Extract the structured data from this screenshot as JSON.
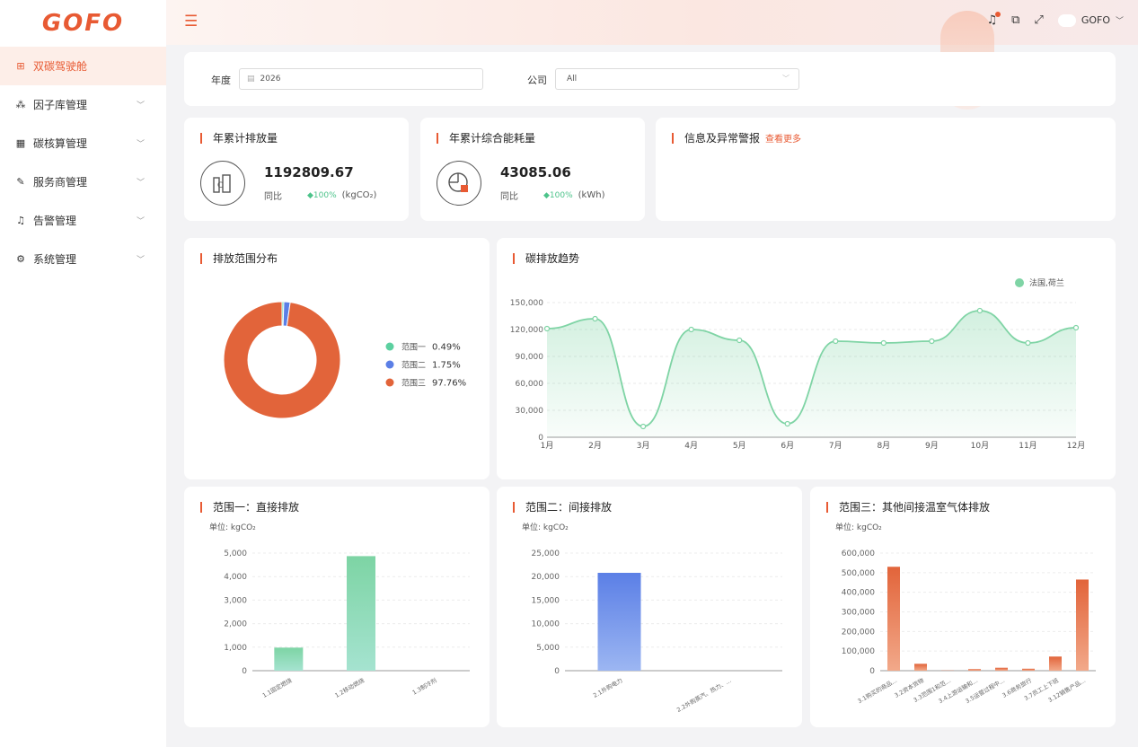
{
  "brand": {
    "logo_text": "GOFO",
    "accent": "#e85a33"
  },
  "sidebar": {
    "items": [
      {
        "label": "双碳驾驶舱",
        "icon": "grid-icon",
        "active": true
      },
      {
        "label": "因子库管理",
        "icon": "factor-icon",
        "active": false
      },
      {
        "label": "碳核算管理",
        "icon": "calc-icon",
        "active": false
      },
      {
        "label": "服务商管理",
        "icon": "provider-icon",
        "active": false
      },
      {
        "label": "告警管理",
        "icon": "bell-icon",
        "active": false
      },
      {
        "label": "系统管理",
        "icon": "settings-icon",
        "active": false
      }
    ]
  },
  "topbar": {
    "user_name": "GOFO"
  },
  "filters": {
    "year_label": "年度",
    "year_value": "2026",
    "company_label": "公司",
    "company_value": "All"
  },
  "kpis": {
    "emission": {
      "title": "年累计排放量",
      "value": "1192809.67",
      "yoy_label": "同比",
      "change": "100%",
      "unit": "(kgCO₂)"
    },
    "energy": {
      "title": "年累计综合能耗量",
      "value": "43085.06",
      "yoy_label": "同比",
      "change": "100%",
      "unit": "(kWh)"
    },
    "alerts": {
      "title": "信息及异常警报",
      "more_link": "查看更多"
    }
  },
  "scope_distribution": {
    "title": "排放范围分布",
    "chart_data": {
      "type": "pie",
      "labels": [
        "范围一",
        "范围二",
        "范围三"
      ],
      "values": [
        0.49,
        1.75,
        97.76
      ],
      "value_labels": [
        "0.49%",
        "1.75%",
        "97.76%"
      ],
      "colors": [
        "#5cd0a0",
        "#5b7fe6",
        "#e2643a"
      ]
    }
  },
  "trend": {
    "title": "碳排放趋势",
    "chart_data": {
      "type": "area",
      "x": [
        "1月",
        "2月",
        "3月",
        "4月",
        "5月",
        "6月",
        "7月",
        "8月",
        "9月",
        "10月",
        "11月",
        "12月"
      ],
      "series": [
        {
          "name": "法国,荷兰",
          "values": [
            121000,
            132000,
            12000,
            120000,
            108000,
            15000,
            107000,
            105000,
            107000,
            141000,
            105000,
            122000
          ],
          "color": "#7fd4a5"
        }
      ],
      "yticks": [
        "0",
        "30,000",
        "60,000",
        "90,000",
        "120,000",
        "150,000"
      ],
      "ylim": [
        0,
        150000
      ],
      "legend": "top-right"
    }
  },
  "scope1": {
    "title": "范围一：直接排放",
    "unit_label": "单位: kgCO₂",
    "chart_data": {
      "type": "bar",
      "categories": [
        "1.1固定燃烧",
        "1.2移动燃烧",
        "1.3制冷剂"
      ],
      "values": [
        980,
        4870,
        0
      ],
      "yticks": [
        "0",
        "1,000",
        "2,000",
        "3,000",
        "4,000",
        "5,000"
      ],
      "ylim": [
        0,
        5000
      ],
      "color_top": "#7dd4a4",
      "color_bottom": "#a5e3d0"
    }
  },
  "scope2": {
    "title": "范围二：间接排放",
    "unit_label": "单位: kgCO₂",
    "chart_data": {
      "type": "bar",
      "categories": [
        "2.1外购电力",
        "2.2外购蒸汽、热力、..."
      ],
      "values": [
        20800,
        0
      ],
      "yticks": [
        "0",
        "5,000",
        "10,000",
        "15,000",
        "20,000",
        "25,000"
      ],
      "ylim": [
        0,
        25000
      ],
      "color_top": "#5b7fe6",
      "color_bottom": "#9cb6f2"
    }
  },
  "scope3": {
    "title": "范围三：其他间接温室气体排放",
    "unit_label": "单位: kgCO₂",
    "chart_data": {
      "type": "bar",
      "categories": [
        "3.1购买的商品...",
        "3.2资本货物",
        "3.3范围1和范...",
        "3.4上游运输和...",
        "3.5运营过程中...",
        "3.6商务旅行",
        "3.7员工上下班",
        "3.12销售产品..."
      ],
      "values": [
        530000,
        35000,
        1000,
        8000,
        15000,
        10000,
        72000,
        465000
      ],
      "yticks": [
        "0",
        "100,000",
        "200,000",
        "300,000",
        "400,000",
        "500,000",
        "600,000"
      ],
      "ylim": [
        0,
        600000
      ],
      "color_top": "#e2643a",
      "color_bottom": "#f2a98a"
    }
  }
}
